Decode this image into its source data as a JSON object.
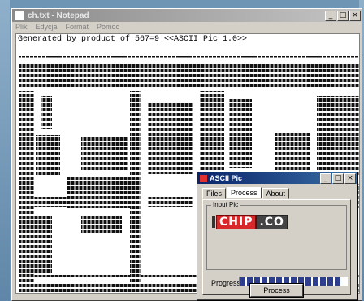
{
  "notepad": {
    "title": "ch.txt - Notepad",
    "menu": [
      "Plik",
      "Edycja",
      "Format",
      "Pomoc"
    ],
    "header_line": "Generated by product of 567=9 <<ASCII Pic 1.0>>"
  },
  "dialog": {
    "title": "ASCII Pic",
    "tabs": [
      "Files",
      "Process",
      "About"
    ],
    "active_tab": "Process",
    "group_label": "Input Pic",
    "logo_text_1": "CHIP",
    "logo_text_2": ".CO",
    "progress_label": "Progress :",
    "progress_value": 0.95,
    "process_button": "Process"
  },
  "colors": {
    "desktop": "#6f95b5",
    "titlebar_active_start": "#0a246a",
    "titlebar_active_end": "#3a6ea5",
    "progress": "#2c3e8c",
    "logo_red": "#d8282a"
  }
}
